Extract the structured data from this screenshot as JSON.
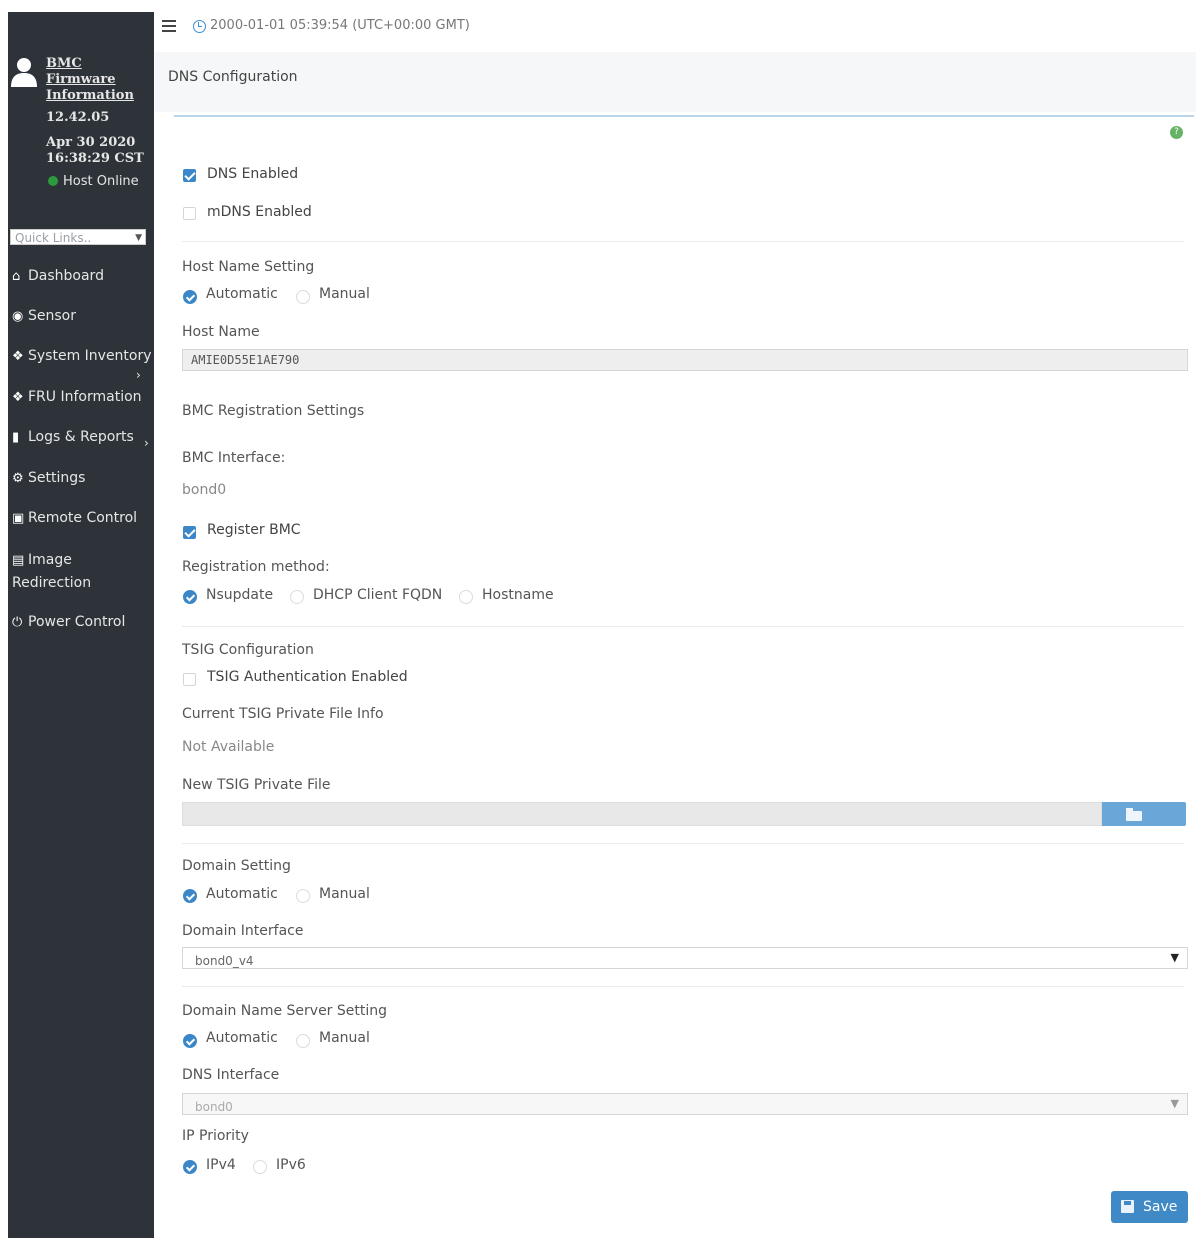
{
  "topbar": {
    "datetime": "2000-01-01 05:39:54 (UTC+00:00 GMT)"
  },
  "sidebar": {
    "firmware_link": "BMC Firmware Information",
    "firmware_version": "12.42.05",
    "firmware_date": "Apr 30 2020 16:38:29 CST",
    "host_status": "Host Online",
    "quick_links_placeholder": "Quick Links..",
    "nav": [
      {
        "label": "Dashboard",
        "icon": "home-icon"
      },
      {
        "label": "Sensor",
        "icon": "sensor-icon"
      },
      {
        "label": "System Inventory",
        "icon": "info-icon"
      },
      {
        "label": "FRU Information",
        "icon": "info-icon"
      },
      {
        "label": "Logs & Reports",
        "icon": "bar-chart-icon"
      },
      {
        "label": "Settings",
        "icon": "gear-icon"
      },
      {
        "label": "Remote Control",
        "icon": "monitor-icon"
      },
      {
        "label": "Image Redirection",
        "icon": "disk-icon"
      },
      {
        "label": "Power Control",
        "icon": "power-icon"
      }
    ]
  },
  "page": {
    "title": "DNS Configuration"
  },
  "form": {
    "dns_enabled_label": "DNS Enabled",
    "dns_enabled": true,
    "mdns_enabled_label": "mDNS Enabled",
    "mdns_enabled": false,
    "host_name_setting_label": "Host Name Setting",
    "host_name_setting_options": [
      "Automatic",
      "Manual"
    ],
    "host_name_setting_selected": "Automatic",
    "host_name_label": "Host Name",
    "host_name_value": "AMIE0D55E1AE790",
    "bmc_registration_label": "BMC Registration Settings",
    "bmc_interface_label": "BMC Interface:",
    "bmc_interface_value": "bond0",
    "register_bmc_label": "Register BMC",
    "register_bmc": true,
    "registration_method_label": "Registration method:",
    "registration_method_options": [
      "Nsupdate",
      "DHCP Client FQDN",
      "Hostname"
    ],
    "registration_method_selected": "Nsupdate",
    "tsig_config_label": "TSIG Configuration",
    "tsig_auth_label": "TSIG Authentication Enabled",
    "tsig_auth_enabled": false,
    "current_tsig_label": "Current TSIG Private File Info",
    "current_tsig_value": "Not Available",
    "new_tsig_label": "New TSIG Private File",
    "domain_setting_label": "Domain Setting",
    "domain_setting_options": [
      "Automatic",
      "Manual"
    ],
    "domain_setting_selected": "Automatic",
    "domain_interface_label": "Domain Interface",
    "domain_interface_value": "bond0_v4",
    "dns_server_setting_label": "Domain Name Server Setting",
    "dns_server_setting_options": [
      "Automatic",
      "Manual"
    ],
    "dns_server_setting_selected": "Automatic",
    "dns_interface_label": "DNS Interface",
    "dns_interface_value": "bond0",
    "ip_priority_label": "IP Priority",
    "ip_priority_options": [
      "IPv4",
      "IPv6"
    ],
    "ip_priority_selected": "IPv4",
    "save_label": "Save"
  },
  "colors": {
    "sidebar_bg": "#2d3338",
    "accent": "#3b87c8",
    "host_online": "#2d9a3d"
  }
}
